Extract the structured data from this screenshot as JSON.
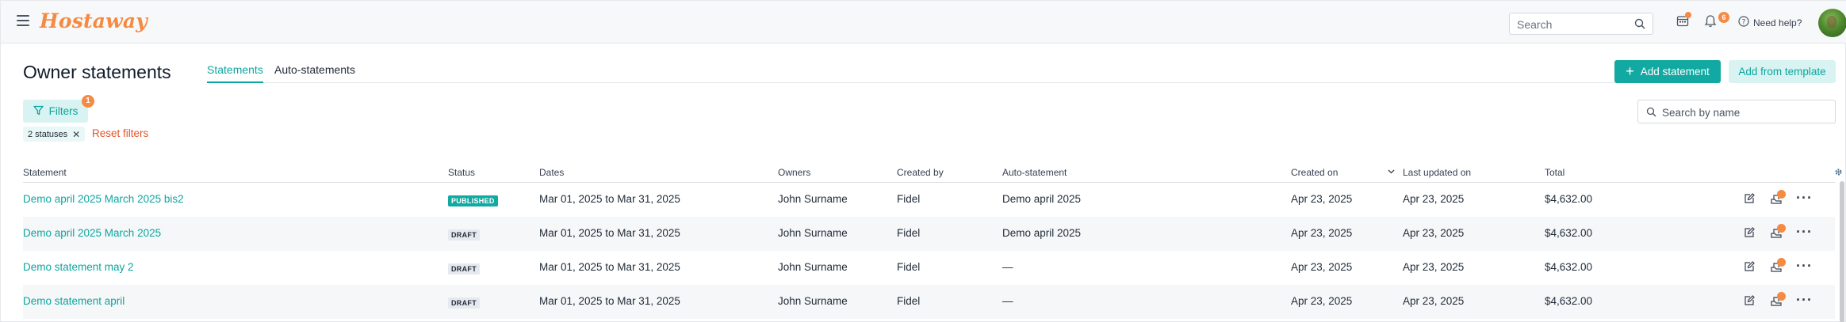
{
  "header": {
    "logo_text": "Hostaway",
    "search_placeholder": "Search",
    "notification_count": "6",
    "help_label": "Need help?"
  },
  "page": {
    "title": "Owner statements",
    "tabs": [
      {
        "label": "Statements",
        "active": true
      },
      {
        "label": "Auto-statements",
        "active": false
      }
    ],
    "add_statement_label": "Add statement",
    "add_from_template_label": "Add from template",
    "filters_label": "Filters",
    "filters_count": "1",
    "filter_chip_label": "2 statuses",
    "reset_filters_label": "Reset filters",
    "search_by_name_placeholder": "Search by name"
  },
  "table": {
    "columns": [
      "Statement",
      "Status",
      "Dates",
      "Owners",
      "Created by",
      "Auto-statement",
      "Created on",
      "Last updated on",
      "Total"
    ],
    "rows": [
      {
        "statement": "Demo april 2025 March 2025 bis2",
        "status": "PUBLISHED",
        "dates": "Mar 01, 2025 to Mar 31, 2025",
        "owners": "John Surname",
        "created_by": "Fidel",
        "auto_statement": "Demo april 2025",
        "created_on": "Apr 23, 2025",
        "last_updated_on": "Apr 23, 2025",
        "total": "$4,632.00"
      },
      {
        "statement": "Demo april 2025 March 2025",
        "status": "DRAFT",
        "dates": "Mar 01, 2025 to Mar 31, 2025",
        "owners": "John Surname",
        "created_by": "Fidel",
        "auto_statement": "Demo april 2025",
        "created_on": "Apr 23, 2025",
        "last_updated_on": "Apr 23, 2025",
        "total": "$4,632.00"
      },
      {
        "statement": "Demo statement may 2",
        "status": "DRAFT",
        "dates": "Mar 01, 2025 to Mar 31, 2025",
        "owners": "John Surname",
        "created_by": "Fidel",
        "auto_statement": "—",
        "created_on": "Apr 23, 2025",
        "last_updated_on": "Apr 23, 2025",
        "total": "$4,632.00"
      },
      {
        "statement": "Demo statement april",
        "status": "DRAFT",
        "dates": "Mar 01, 2025 to Mar 31, 2025",
        "owners": "John Surname",
        "created_by": "Fidel",
        "auto_statement": "—",
        "created_on": "Apr 23, 2025",
        "last_updated_on": "Apr 23, 2025",
        "total": "$4,632.00"
      }
    ]
  },
  "colors": {
    "brand_orange": "#f58a42",
    "accent_teal": "#11a9a1",
    "danger_red": "#e1532a"
  }
}
